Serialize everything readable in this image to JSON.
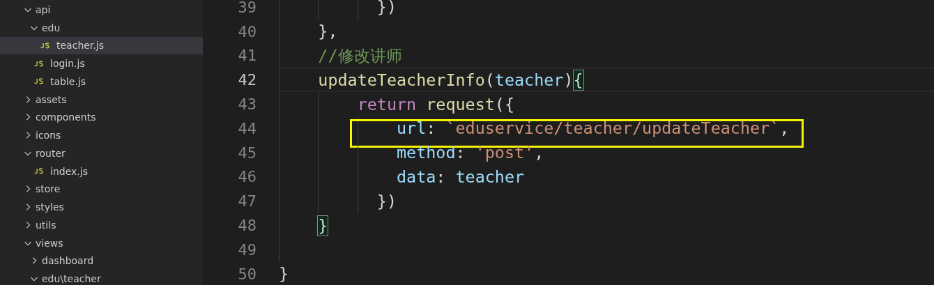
{
  "explorer": {
    "items": [
      {
        "kind": "folder",
        "name": "api",
        "expanded": true,
        "selected": false,
        "children": [
          {
            "kind": "folder",
            "name": "edu",
            "expanded": true,
            "selected": false,
            "children": [
              {
                "kind": "file",
                "name": "teacher.js",
                "selected": true
              }
            ]
          },
          {
            "kind": "file",
            "name": "login.js",
            "selected": false
          },
          {
            "kind": "file",
            "name": "table.js",
            "selected": false
          }
        ]
      },
      {
        "kind": "folder",
        "name": "assets",
        "expanded": false,
        "selected": false
      },
      {
        "kind": "folder",
        "name": "components",
        "expanded": false,
        "selected": false
      },
      {
        "kind": "folder",
        "name": "icons",
        "expanded": false,
        "selected": false
      },
      {
        "kind": "folder",
        "name": "router",
        "expanded": true,
        "selected": false,
        "children": [
          {
            "kind": "file",
            "name": "index.js",
            "selected": false
          }
        ]
      },
      {
        "kind": "folder",
        "name": "store",
        "expanded": false,
        "selected": false
      },
      {
        "kind": "folder",
        "name": "styles",
        "expanded": false,
        "selected": false
      },
      {
        "kind": "folder",
        "name": "utils",
        "expanded": false,
        "selected": false
      },
      {
        "kind": "folder",
        "name": "views",
        "expanded": true,
        "selected": false,
        "children": [
          {
            "kind": "folder",
            "name": "dashboard",
            "expanded": false,
            "selected": false
          },
          {
            "kind": "folder",
            "name": "edu\\teacher",
            "expanded": true,
            "selected": false
          }
        ]
      }
    ]
  },
  "editor": {
    "lines": [
      {
        "number": "39",
        "current": false,
        "boxed": false,
        "tokens": [
          {
            "kind": "punct",
            "text": "          })"
          }
        ]
      },
      {
        "number": "40",
        "current": false,
        "boxed": false,
        "tokens": [
          {
            "kind": "punct",
            "text": "    },"
          }
        ]
      },
      {
        "number": "41",
        "current": false,
        "boxed": false,
        "tokens": [
          {
            "kind": "comment",
            "text": "    //修改讲师"
          }
        ]
      },
      {
        "number": "42",
        "current": true,
        "boxed": false,
        "tokens": [
          {
            "kind": "function",
            "text": "    updateTeacherInfo"
          },
          {
            "kind": "punct",
            "text": "("
          },
          {
            "kind": "param",
            "text": "teacher"
          },
          {
            "kind": "punct",
            "text": ")"
          },
          {
            "kind": "match",
            "text": "{"
          }
        ]
      },
      {
        "number": "43",
        "current": false,
        "boxed": false,
        "tokens": [
          {
            "kind": "keyword",
            "text": "        return"
          },
          {
            "kind": "function",
            "text": " request"
          },
          {
            "kind": "punct",
            "text": "({"
          }
        ]
      },
      {
        "number": "44",
        "current": false,
        "boxed": true,
        "tokens": [
          {
            "kind": "property",
            "text": "            url"
          },
          {
            "kind": "punct",
            "text": ": "
          },
          {
            "kind": "string",
            "text": "`eduservice/teacher/updateTeacher`"
          },
          {
            "kind": "punct",
            "text": ","
          }
        ]
      },
      {
        "number": "45",
        "current": false,
        "boxed": false,
        "tokens": [
          {
            "kind": "property",
            "text": "            method"
          },
          {
            "kind": "punct",
            "text": ": "
          },
          {
            "kind": "string",
            "text": "'post'"
          },
          {
            "kind": "punct",
            "text": ","
          }
        ]
      },
      {
        "number": "46",
        "current": false,
        "boxed": false,
        "tokens": [
          {
            "kind": "property",
            "text": "            data"
          },
          {
            "kind": "punct",
            "text": ": "
          },
          {
            "kind": "param",
            "text": "teacher"
          }
        ]
      },
      {
        "number": "47",
        "current": false,
        "boxed": false,
        "tokens": [
          {
            "kind": "punct",
            "text": "          })"
          }
        ]
      },
      {
        "number": "48",
        "current": false,
        "boxed": false,
        "tokens": [
          {
            "kind": "match",
            "text": "    }"
          }
        ]
      },
      {
        "number": "49",
        "current": false,
        "boxed": false
      },
      {
        "number": "50",
        "current": false,
        "boxed": false,
        "tokens": [
          {
            "kind": "punct",
            "text": "}"
          }
        ]
      }
    ]
  }
}
